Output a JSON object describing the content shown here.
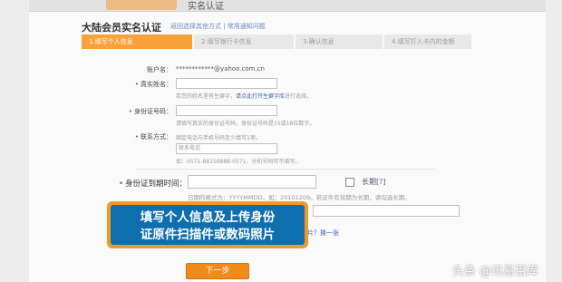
{
  "header": {
    "title": "实名认证"
  },
  "page": {
    "heading": "大陆会员实名认证",
    "heading_links": "返回选择其他方式 | 常用通知问题"
  },
  "steps": [
    {
      "label": "1.填写个人信息",
      "active": true
    },
    {
      "label": "2.填写银行卡信息",
      "active": false
    },
    {
      "label": "3.确认信息",
      "active": false
    },
    {
      "label": "4.填写打入卡内的金额",
      "active": false
    }
  ],
  "form": {
    "account_label": "账户名：",
    "account_value": "************@yahoo.com.cn",
    "realname_label": "真实姓名：",
    "realname_value": "",
    "realname_hint": "若您的姓名里有生僻字，",
    "realname_hint_link": "请点此打开生僻字库",
    "realname_hint_tail": "进行选择。",
    "id_label": "身份证号码：",
    "id_value": "",
    "id_hint": "请填写真实的身份证号码，身份证号码是15或18位数字。",
    "contact_label": "联系方式：",
    "contact_hint": "固定电话与手机号码至少填写1项。",
    "mobile_placeholder": "联系电话",
    "phone_hint": "如：0571-88156888-0571，分机号码可不填写。",
    "expiry_label": "身份证到期时间：",
    "expiry_value": "",
    "longterm_label": "长期",
    "longterm_help": "[?]",
    "expiry_hint": "日期的格式为：YYYYMMDD，如：20101209。若证件有效期为长期，请勾选长期。"
  },
  "callout": {
    "line1": "填写个人信息及上传身份",
    "line2": "证原件扫描件或数码照片"
  },
  "refresh_link": "片？换一张",
  "next_button": "下一步",
  "watermark": "头条 @讯易百库",
  "colors": {
    "accent": "#f7a33a",
    "callout_blue": "#0f6fae",
    "callout_border": "#f39a23",
    "link": "#3a62b5"
  }
}
